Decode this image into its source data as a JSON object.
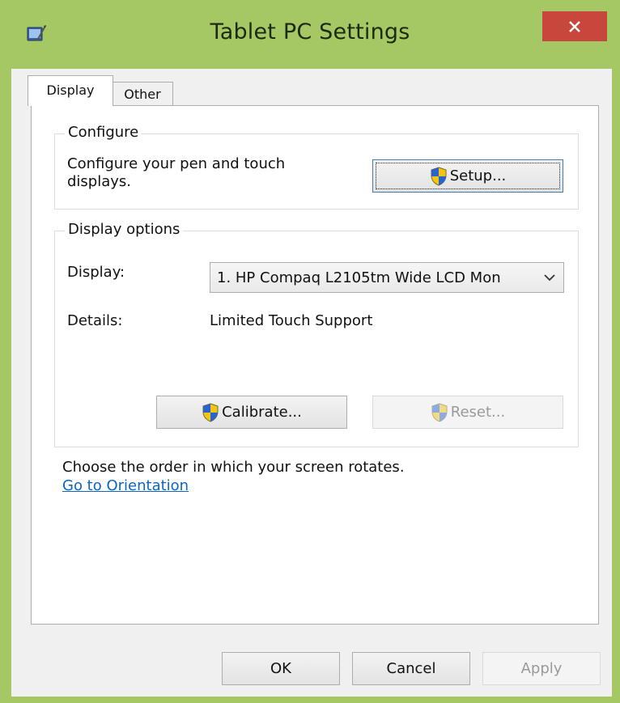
{
  "window": {
    "title": "Tablet PC Settings",
    "close_label": "×"
  },
  "tabs": [
    {
      "label": "Display",
      "active": true
    },
    {
      "label": "Other",
      "active": false
    }
  ],
  "configure": {
    "group_title": "Configure",
    "description_line1": "Configure your pen and touch",
    "description_line2": "displays.",
    "setup_button": "Setup..."
  },
  "display_options": {
    "group_title": "Display options",
    "display_label": "Display:",
    "display_value": "1. HP Compaq L2105tm Wide LCD Mon",
    "details_label": "Details:",
    "details_value": "Limited Touch Support",
    "calibrate_button": "Calibrate...",
    "reset_button": "Reset..."
  },
  "orientation": {
    "text": "Choose the order in which your screen rotates.",
    "link": "Go to Orientation"
  },
  "footer": {
    "ok": "OK",
    "cancel": "Cancel",
    "apply": "Apply"
  },
  "colors": {
    "titlebar": "#a5c864",
    "close": "#c9463d",
    "link": "#0b66c2"
  }
}
